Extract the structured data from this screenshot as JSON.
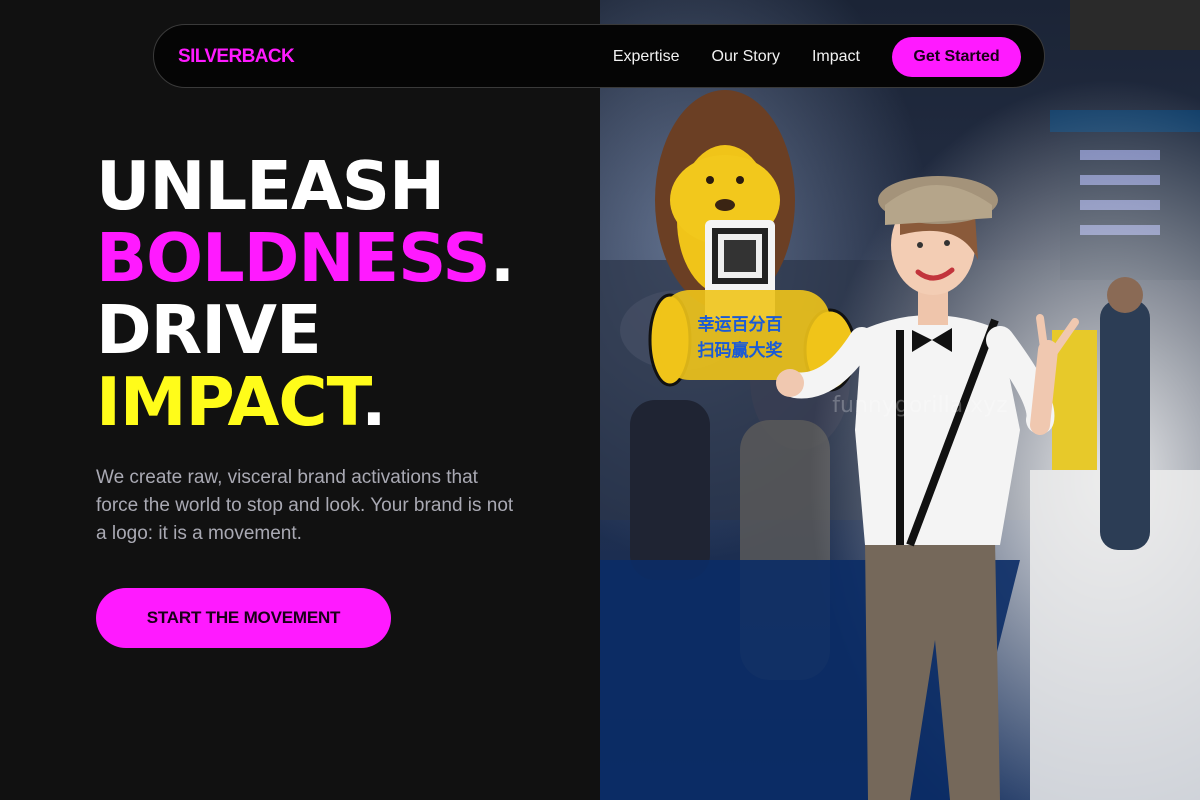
{
  "brand": {
    "logo_text": "SILVERBACK",
    "accent_color": "#ff1aff",
    "highlight_color": "#fffc1a",
    "background_color": "#111111"
  },
  "nav": {
    "links": [
      "Expertise",
      "Our Story",
      "Impact"
    ],
    "cta_label": "Get Started"
  },
  "hero": {
    "title_lines": [
      {
        "text": "UNLEASH",
        "color": "white",
        "dot": ""
      },
      {
        "text": "BOLDNESS",
        "color": "pink",
        "dot": "."
      },
      {
        "text": "DRIVE",
        "color": "white",
        "dot": ""
      },
      {
        "text": "IMPACT",
        "color": "yellow",
        "dot": "."
      }
    ],
    "description": "We create raw, visceral brand activations that force the world to stop and look. Your brand is not a logo: it is a movement.",
    "cta_label": "START THE MOVEMENT"
  },
  "photo": {
    "sign_text_line1": "幸运百分百",
    "sign_text_line2": "扫码赢大奖",
    "watermark": "funnygorilla.xyz"
  }
}
